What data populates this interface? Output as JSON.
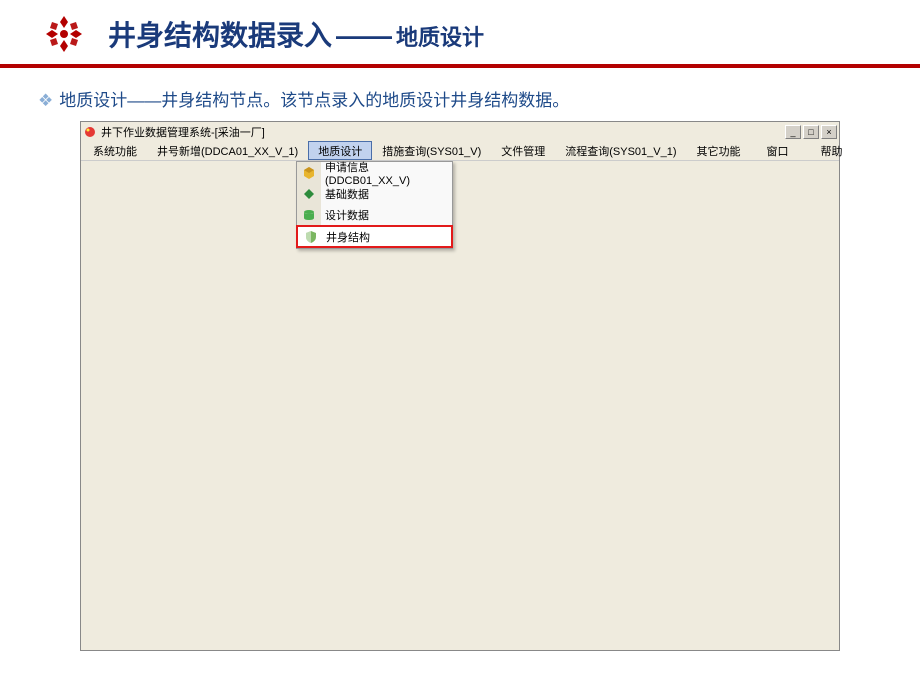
{
  "slide": {
    "title_main": "井身结构数据录入",
    "title_sep": "——",
    "title_sub": "地质设计",
    "description_prefix": "地质设计——井身结构节点。",
    "description_rest": "该节点录入的地质设计井身结构数据。"
  },
  "window": {
    "title": "井下作业数据管理系统-[采油一厂]"
  },
  "menubar": {
    "items": [
      {
        "label": "系统功能"
      },
      {
        "label": "井号新增(DDCA01_XX_V_1)"
      },
      {
        "label": "地质设计",
        "active": true
      },
      {
        "label": "措施查询(SYS01_V)"
      },
      {
        "label": "文件管理"
      },
      {
        "label": "流程查询(SYS01_V_1)"
      },
      {
        "label": "其它功能"
      }
    ],
    "right": [
      {
        "label": "窗口"
      },
      {
        "label": "帮助"
      }
    ]
  },
  "dropdown": {
    "items": [
      {
        "label": "申请信息(DDCB01_XX_V)",
        "icon": "yellow-cube"
      },
      {
        "label": "基础数据",
        "icon": "green-diamond"
      },
      {
        "label": "设计数据",
        "icon": "green-db"
      },
      {
        "label": "井身结构",
        "icon": "shield",
        "highlighted": true
      }
    ]
  },
  "window_controls": {
    "minimize": "_",
    "maximize": "□",
    "close": "×"
  }
}
